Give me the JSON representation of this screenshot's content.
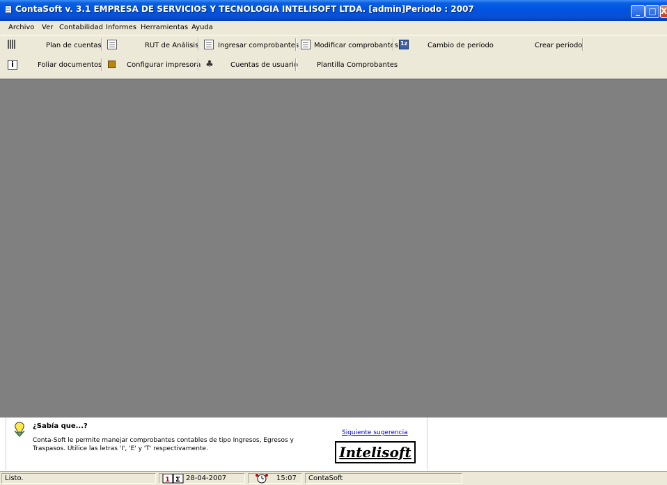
{
  "window": {
    "title": "ContaSoft v. 3.1  EMPRESA DE SERVICIOS Y TECNOLOGIA INTELISOFT LTDA. [admin]Periodo : 2007",
    "buttons": [
      "_",
      "□",
      "X"
    ]
  },
  "menu": [
    {
      "label": "Archivo"
    },
    {
      "label": "Ver"
    },
    {
      "label": "Contabilidad"
    },
    {
      "label": "Informes"
    },
    {
      "label": "Herramientas"
    },
    {
      "label": "Ayuda"
    }
  ],
  "toolbar1": {
    "plan": "Plan de cuentas",
    "rut": "RUT de Análisis",
    "ingresar": "Ingresar comprobantes",
    "modificar": "Modificar comprobantes",
    "cambio": "Cambio de período",
    "crear": "Crear período"
  },
  "toolbar2": {
    "foliar": "Foliar documentos",
    "configurar": "Configurar impresora",
    "cuentas": "Cuentas de usuario",
    "plantilla": "Plantilla Comprobantes"
  },
  "tip": {
    "title": "¿Sabía que...?",
    "body": "Conta-Soft le permite manejar comprobantes contables de tipo Ingresos, Egresos y Traspasos. Utilice las letras 'I', 'E' y 'T' respectivamente.",
    "next": "Siguiente sugerencia",
    "logo": "Intelisoft"
  },
  "status": {
    "message": "Listo.",
    "date": "28-04-2007",
    "time": "15:07",
    "app": "ContaSoft"
  },
  "icons": [
    "app-icon",
    "grip-icon",
    "document-icon",
    "calculator-icon",
    "info-icon",
    "book-icon",
    "user-icon",
    "bulb-icon",
    "calendar-icon",
    "clock-icon"
  ]
}
